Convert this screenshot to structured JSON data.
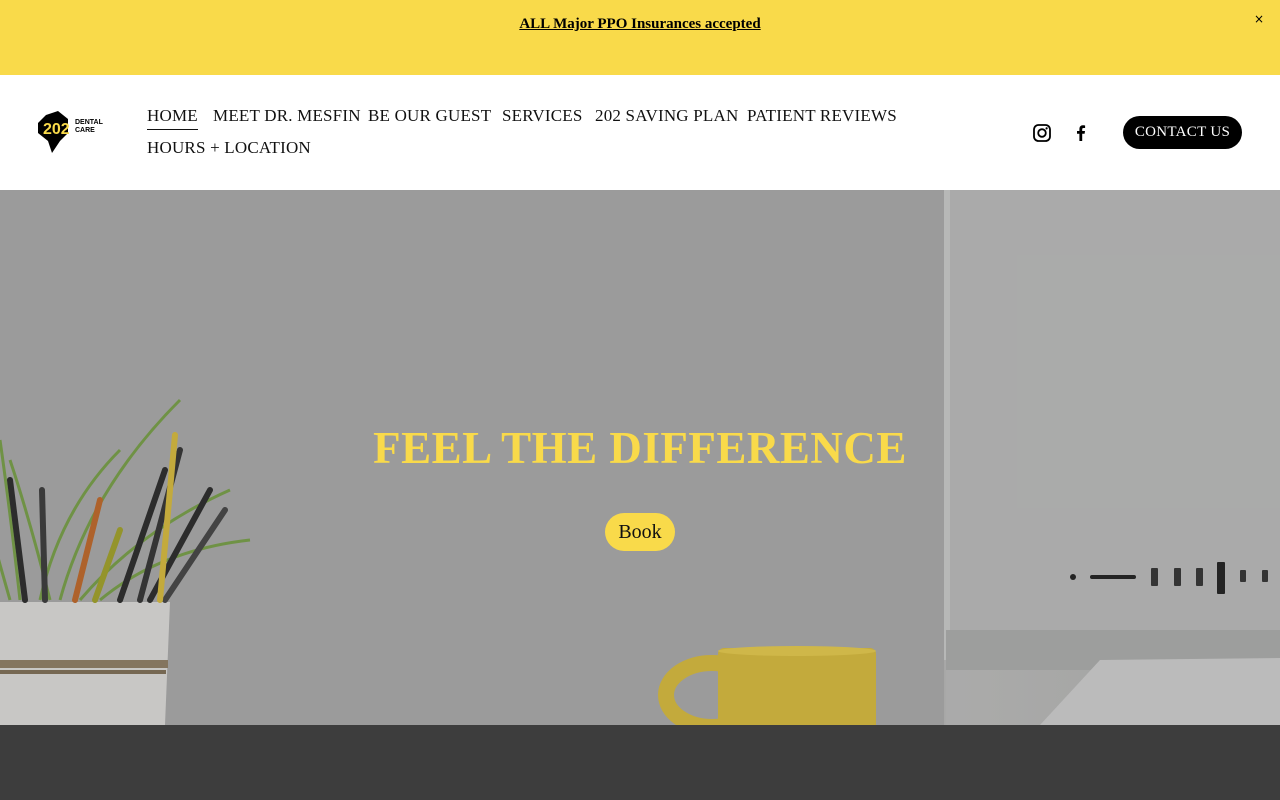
{
  "announcement": {
    "text": "ALL Major PPO Insurances accepted",
    "close": "×"
  },
  "header": {
    "logo": {
      "number": "202",
      "line1": "DENTAL",
      "line2": "CARE"
    },
    "nav": [
      {
        "label": "HOME",
        "active": true
      },
      {
        "label": "MEET DR. MESFIN"
      },
      {
        "label": "BE OUR GUEST"
      },
      {
        "label": "SERVICES"
      },
      {
        "label": "202 SAVING PLAN"
      },
      {
        "label": "PATIENT REVIEWS"
      },
      {
        "label": "HOURS + LOCATION"
      }
    ],
    "social": [
      "instagram-icon",
      "facebook-icon"
    ],
    "contact_label": "CONTACT US"
  },
  "hero": {
    "title": "FEEL THE DIFFERENCE",
    "button_label": "Book"
  },
  "colors": {
    "accent_yellow": "#f9da4a",
    "dark": "#000000",
    "footer_band": "#3d3d3d"
  }
}
